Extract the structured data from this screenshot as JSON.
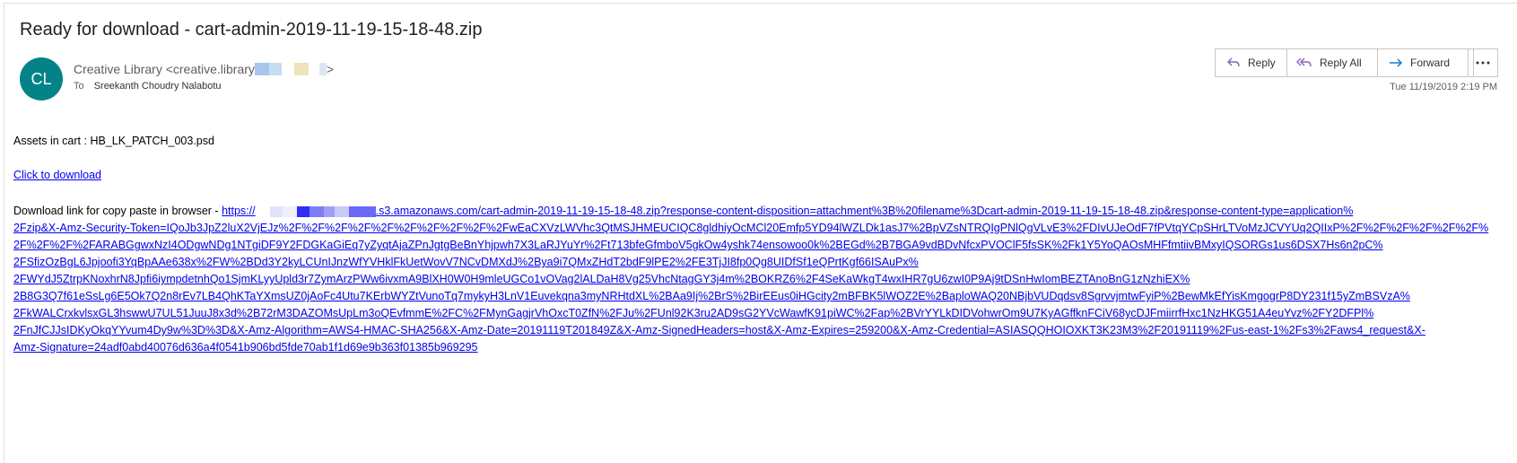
{
  "email": {
    "subject": "Ready for download - cart-admin-2019-11-19-15-18-48.zip",
    "avatar_initials": "CL",
    "avatar_color": "#038387",
    "sender_display": "Creative Library <creative.library",
    "sender_suffix": ">",
    "to_label": "To",
    "to_name": "Sreekanth Choudry Nalabotu",
    "timestamp": "Tue 11/19/2019 2:19 PM"
  },
  "actions": {
    "reply_label": "Reply",
    "reply_all_label": "Reply All",
    "forward_label": "Forward",
    "more_icon": "ellipsis-icon"
  },
  "body": {
    "assets_line": "Assets in cart : HB_LK_PATCH_003.psd",
    "click_link": "Click to download",
    "copy_prefix": "Download link for copy paste in browser - ",
    "url_lines": [
      "https://",
      ".s3.amazonaws.com/cart-admin-2019-11-19-15-18-48.zip?response-content-disposition=attachment%3B%20filename%3Dcart-admin-2019-11-19-15-18-48.zip&response-content-type=application%",
      "2Fzip&X-Amz-Security-Token=IQoJb3JpZ2luX2VjEJz%2F%2F%2F%2F%2F%2F%2F%2F%2F%2FwEaCXVzLWVhc3QtMSJHMEUCIQC8gldhiyOcMCl20Emfp5YD94lWZLDk1asJ7%2BpVZsNTRQIgPNlQgVLvE3%2FDIvUJeOdF7fPVtqYCpSHrLTVoMzJCVYUq2QIIxP%2F%2F%2F%2F%2F%2F%",
      "2F%2F%2F%2FARABGgwxNzI4ODgwNDg1NTgiDF9Y2FDGKaGiEq7yZyqtAjaZPnJgtgBeBnYhjpwh7X3LaRJYuYr%2Ft713bfeGfmboV5gkOw4yshk74ensowoo0k%2BEGd%2B7BGA9vdBDvNfcxPVOClF5fsSK%2Fk1Y5YoQAOsMHFfmtiivBMxyIQSORGs1us6DSX7Hs6n2pC%",
      "2FSfizOzBgL6Jpjoofi3YqBpAAe638x%2FW%2BDd3Y2kyLCUnIJnzWfYVHklFkUetWovV7NCvDMXdJ%2Bya9i7QMxZHdT2bdF9lPE2%2FE3TjJI8fp0Qg8UIDfSf1eQPrtKgf66ISAuPx%",
      "2FWYdJ5ZtrpKNoxhrN8Jpfi6iympdetnhQo1SjmKLyyUpld3r7ZymArzPWw6ivxmA9BlXH0W0H9mleUGCo1vOVag2lALDaH8Vg25VhcNtagGY3j4m%2BOKRZ6%2F4SeKaWkgT4wxIHR7gU6zwI0P9Aj9tDSnHwIomBEZTAnoBnG1zNzhiEX%",
      "2B8G3Q7f61eSsLg6E5Ok7Q2n8rEv7LB4QhKTaYXmsUZ0jAoFc4Utu7KErbWYZtVunoTq7mykyH3LnV1Euvekqna3myNRHtdXL%2BAa9Ij%2BrS%2BirEEus0iHGcity2mBFBK5lWOZ2E%2BaploWAQ20NBjbVUDqdsv8SgrvvjmtwFyiP%2BewMkEfYisKmgogrP8DY231f15yZmBSVzA%",
      "2FkWALCrxkvlsxGL3hswwU7UL51JuuJ8x3d%2B72rM3DAZOMsUpLm3oQEvfmmE%2FC%2FMynGagjrVhOxcT0ZfN%2FJu%2FUnl92K3ru2AD9sG2YVcWawfK91piWC%2Fap%2BVrYYLkDIDVohwrOm9U7KyAGffknFCiV68ycDJFmiirrfHxc1NzHKG51A4euYvz%2FY2DFPl%",
      "2FnJfCJJsIDKyOkqYYvum4Dy9w%3D%3D&X-Amz-Algorithm=AWS4-HMAC-SHA256&X-Amz-Date=20191119T201849Z&X-Amz-SignedHeaders=host&X-Amz-Expires=259200&X-Amz-Credential=ASIASQQHOIOXKT3K23M3%2F20191119%2Fus-east-1%2Fs3%2Faws4_request&X-",
      "Amz-Signature=24adf0abd40076d636a4f0541b906bd5fde70ab1f1d69e9b363f01385b969295"
    ]
  }
}
